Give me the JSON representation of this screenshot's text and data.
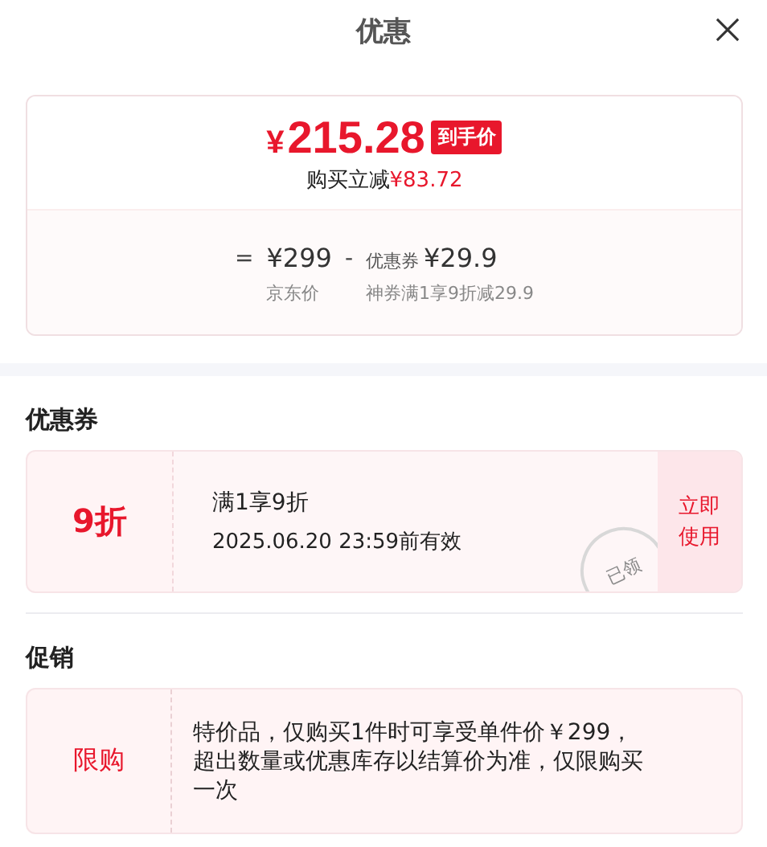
{
  "header": {
    "title": "优惠"
  },
  "summary": {
    "final_price": "215.28",
    "currency": "¥",
    "final_tag": "到手价",
    "saving_label": "购买立减",
    "saving_amount": "¥83.72",
    "formula": [
      {
        "kind": "operator",
        "text": "="
      },
      {
        "kind": "amount",
        "text": "¥299",
        "caption": "京东价"
      },
      {
        "kind": "operator",
        "text": "-"
      },
      {
        "kind": "amount",
        "prefix": "优惠券",
        "text": "¥29.9",
        "caption": "神券满1享9折减29.9"
      }
    ]
  },
  "coupons": {
    "heading": "优惠券",
    "items": [
      {
        "value": "9折",
        "condition": "满1享9折",
        "validity": "2025.06.20 23:59前有效",
        "action": "立即使用",
        "claimed": true,
        "stamp": "已领"
      }
    ]
  },
  "promotions": {
    "heading": "促销",
    "items": [
      {
        "tag": "限购",
        "text": "特价品，仅购买1件时可享受单件价￥299，超出数量或优惠库存以结算价为准，仅限购买一次"
      }
    ]
  }
}
